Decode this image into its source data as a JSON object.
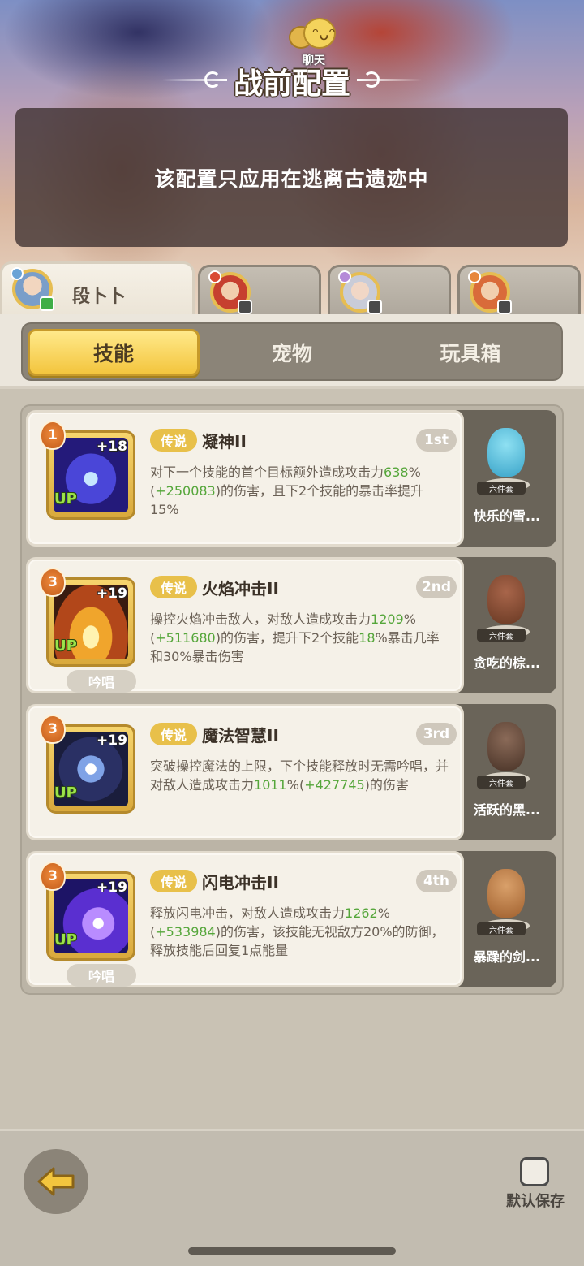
{
  "header": {
    "title": "战前配置",
    "chat_label": "聊天",
    "notice": "该配置只应用在逃离古遗迹中"
  },
  "hero_tabs": [
    {
      "name": "段卜卜",
      "active": true
    },
    {
      "name": "",
      "active": false
    },
    {
      "name": "",
      "active": false
    },
    {
      "name": "",
      "active": false
    }
  ],
  "category_tabs": [
    {
      "label": "技能",
      "active": true
    },
    {
      "label": "宠物",
      "active": false
    },
    {
      "label": "玩具箱",
      "active": false
    }
  ],
  "skills": [
    {
      "level": "1",
      "plus": "+18",
      "up": "UP",
      "rarity": "传说",
      "name": "凝神II",
      "order": "1st",
      "desc_parts": [
        "对下一个技能的首个目标额外造成攻击力",
        "638",
        "%(",
        "+250083",
        ")的伤害，且下2个技能的暴击率提升15%"
      ],
      "chant": "",
      "pet": {
        "name": "快乐的雪...",
        "set": "六件套"
      }
    },
    {
      "level": "3",
      "plus": "+19",
      "up": "UP",
      "rarity": "传说",
      "name": "火焰冲击II",
      "order": "2nd",
      "desc_parts": [
        "操控火焰冲击敌人，对敌人造成攻击力",
        "1209",
        "%(",
        "+511680",
        ")的伤害，提升下2个技能",
        "18",
        "%暴击几率和30%暴击伤害"
      ],
      "chant": "吟唱",
      "pet": {
        "name": "贪吃的棕...",
        "set": "六件套"
      }
    },
    {
      "level": "3",
      "plus": "+19",
      "up": "UP",
      "rarity": "传说",
      "name": "魔法智慧II",
      "order": "3rd",
      "desc_parts": [
        "突破操控魔法的上限，下个技能释放时无需吟唱，并对敌人造成攻击力",
        "1011",
        "%(",
        "+427745",
        ")的伤害"
      ],
      "chant": "",
      "pet": {
        "name": "活跃的黑...",
        "set": "六件套"
      }
    },
    {
      "level": "3",
      "plus": "+19",
      "up": "UP",
      "rarity": "传说",
      "name": "闪电冲击II",
      "order": "4th",
      "desc_parts": [
        "释放闪电冲击，对敌人造成攻击力",
        "1262",
        "%(",
        "+533984",
        ")的伤害，该技能无视敌方20%的防御，释放技能后回复1点能量"
      ],
      "chant": "吟唱",
      "pet": {
        "name": "暴躁的剑...",
        "set": "六件套"
      }
    }
  ],
  "footer": {
    "save_label": "默认保存",
    "save_checked": false
  },
  "colors": {
    "gold": "#f3c53e",
    "highlight_green": "#55a63a",
    "panel_dark": "#8b8478"
  }
}
